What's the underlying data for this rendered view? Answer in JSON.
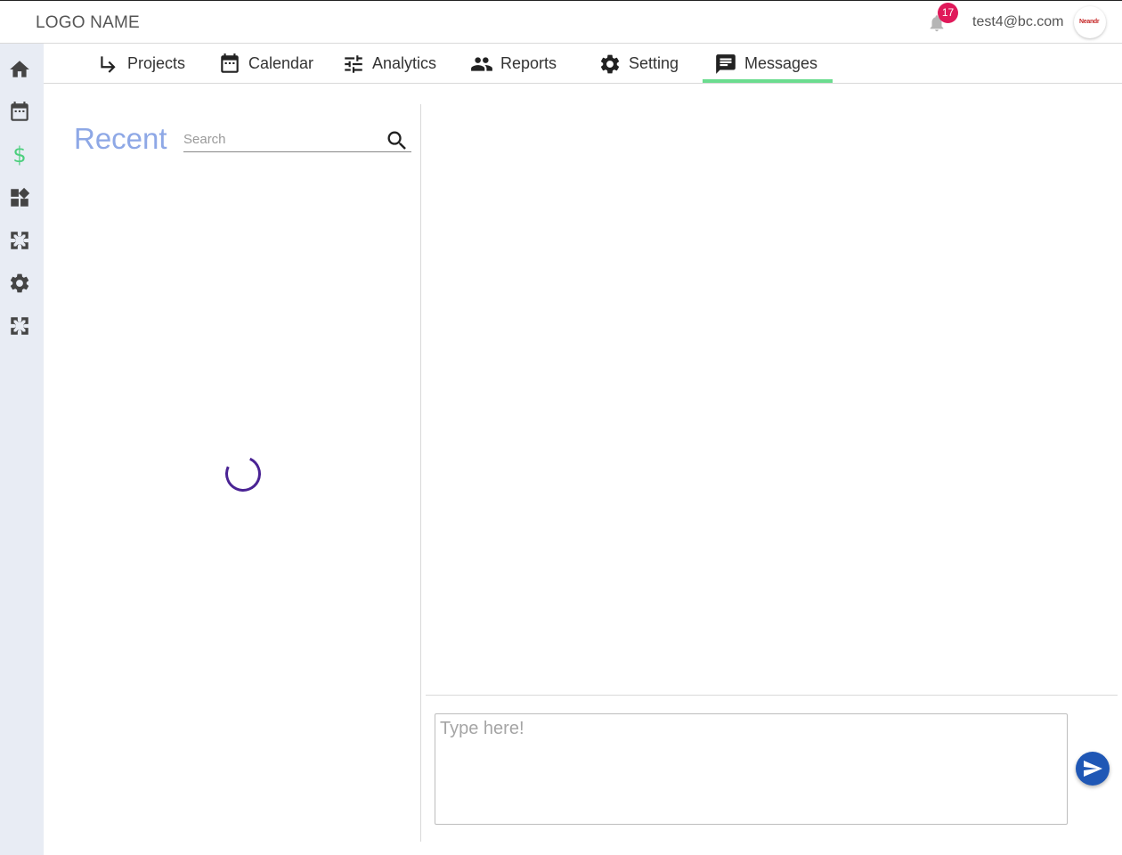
{
  "header": {
    "logo_text": "LOGO NAME",
    "notification_count": "17",
    "user_email": "test4@bc.com",
    "avatar_text": "Neandr"
  },
  "sidebar": {
    "items": [
      {
        "icon": "home-icon"
      },
      {
        "icon": "calendar-icon"
      },
      {
        "icon": "dollar-icon",
        "label": "$",
        "color": "#4ccf7d"
      },
      {
        "icon": "widgets-icon"
      },
      {
        "icon": "puzzle-icon"
      },
      {
        "icon": "gear-icon"
      },
      {
        "icon": "puzzle-icon"
      }
    ]
  },
  "tabs": [
    {
      "label": "Projects",
      "icon": "subdirectory-arrow-icon"
    },
    {
      "label": "Calendar",
      "icon": "calendar-icon"
    },
    {
      "label": "Analytics",
      "icon": "tune-icon"
    },
    {
      "label": "Reports",
      "icon": "people-icon"
    },
    {
      "label": "Setting",
      "icon": "gear-icon"
    },
    {
      "label": "Messages",
      "icon": "chat-icon",
      "active": true
    }
  ],
  "recent": {
    "title": "Recent",
    "search_placeholder": "Search"
  },
  "chat": {
    "input_placeholder": "Type here!"
  },
  "colors": {
    "accent_green": "#6bdc8f",
    "recent_title": "#8ea8e6",
    "badge": "#e0195a",
    "send_button": "#1f57b5",
    "spinner": "#4a2394"
  }
}
